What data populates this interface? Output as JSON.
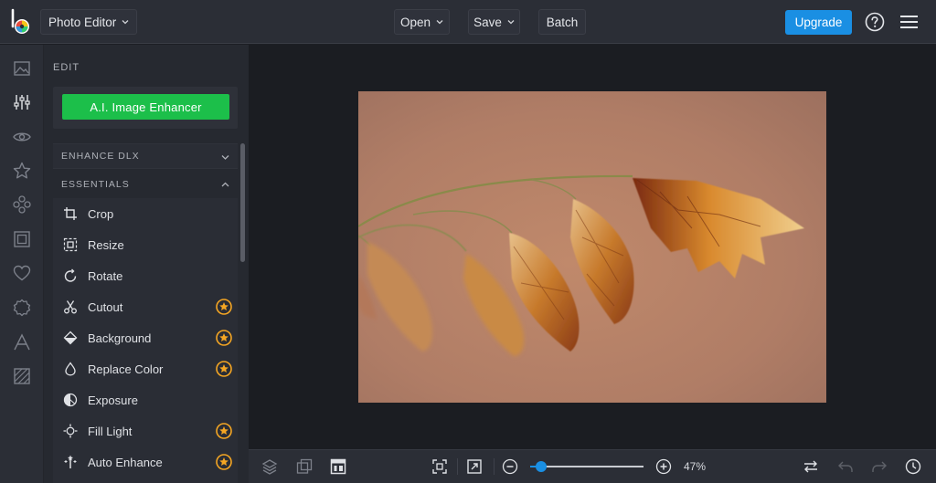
{
  "app": {
    "selector_label": "Photo Editor"
  },
  "toolbar": {
    "open_label": "Open",
    "save_label": "Save",
    "batch_label": "Batch",
    "upgrade_label": "Upgrade"
  },
  "colors": {
    "accent": "#1a8fe3",
    "enhancer": "#1cbf4a",
    "premium_star": "#f5a623"
  },
  "rail": {
    "icons": [
      "image-icon",
      "adjust-sliders-icon",
      "eye-icon",
      "star-icon",
      "elements-icon",
      "frame-icon",
      "heart-icon",
      "badge-icon",
      "text-icon",
      "texture-icon"
    ],
    "active": "adjust-sliders-icon"
  },
  "panel": {
    "title": "EDIT",
    "enhancer_label": "A.I. Image Enhancer",
    "sections": {
      "dlx": "ENHANCE DLX",
      "essentials": "ESSENTIALS"
    },
    "tools": [
      {
        "label": "Crop",
        "icon": "crop-icon",
        "premium": false
      },
      {
        "label": "Resize",
        "icon": "resize-icon",
        "premium": false
      },
      {
        "label": "Rotate",
        "icon": "rotate-icon",
        "premium": false
      },
      {
        "label": "Cutout",
        "icon": "scissors-icon",
        "premium": true
      },
      {
        "label": "Background",
        "icon": "background-icon",
        "premium": true
      },
      {
        "label": "Replace Color",
        "icon": "drop-icon",
        "premium": true
      },
      {
        "label": "Exposure",
        "icon": "exposure-icon",
        "premium": false
      },
      {
        "label": "Fill Light",
        "icon": "fill-light-icon",
        "premium": true
      },
      {
        "label": "Auto Enhance",
        "icon": "magic-wand-icon",
        "premium": true
      }
    ]
  },
  "bottom": {
    "zoom_value": "47%",
    "zoom_fraction": 0.1
  }
}
